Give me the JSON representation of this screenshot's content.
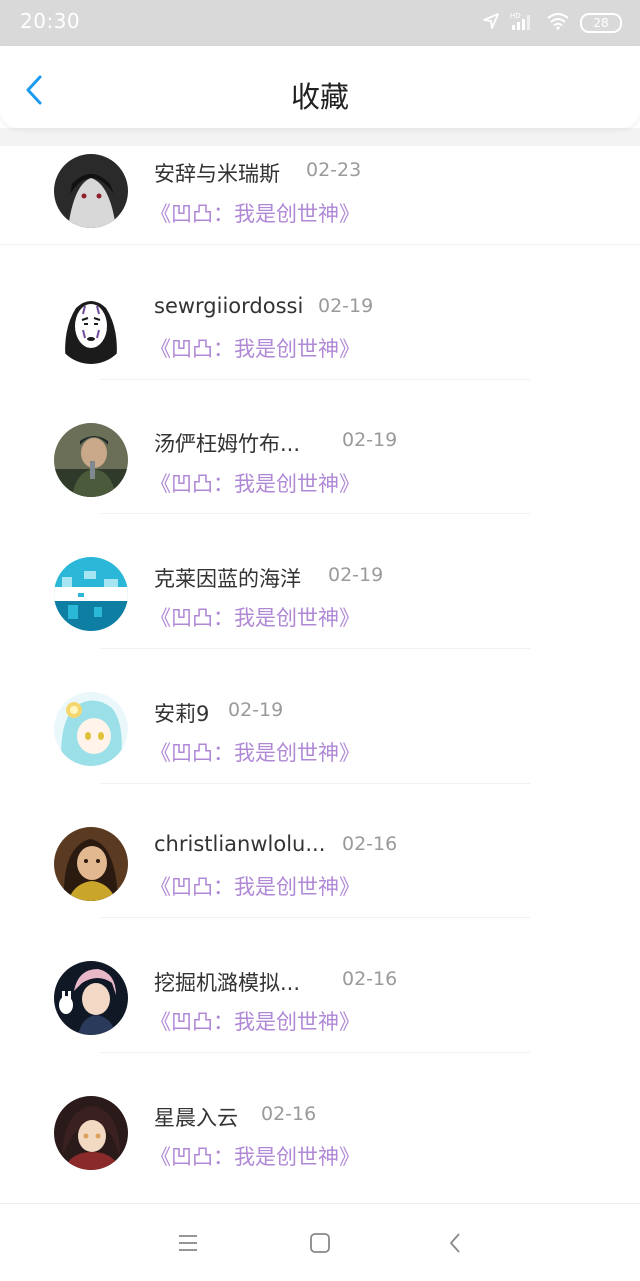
{
  "status_bar": {
    "time": "20:30",
    "battery": "28",
    "icons": [
      "location-icon",
      "hd-signal-icon",
      "wifi-icon",
      "battery-icon"
    ]
  },
  "header": {
    "title": "收藏",
    "back_icon": "chevron-left-icon",
    "accent_color": "#1a9af0"
  },
  "list": {
    "work_color": "#b089d6",
    "items": [
      {
        "name": "安辞与米瑞斯",
        "date": "02-23",
        "work": "《凹凸：我是创世神》",
        "avatar_palette": [
          "#2a2a2a",
          "#d8d8d8",
          "#8c1f2a"
        ]
      },
      {
        "name": "sewrgiiordossi",
        "date": "02-19",
        "work": "《凹凸：我是创世神》",
        "avatar_palette": [
          "#1b1b1b",
          "#ffffff",
          "#6f4c9b"
        ]
      },
      {
        "name": "汤俨枉姆竹布...",
        "date": "02-19",
        "work": "《凹凸：我是创世神》",
        "avatar_palette": [
          "#6c6f57",
          "#c9a98a",
          "#2f3a2a"
        ]
      },
      {
        "name": "克莱因蓝的海洋",
        "date": "02-19",
        "work": "《凹凸：我是创世神》",
        "avatar_palette": [
          "#2bb7d8",
          "#a6e6f2",
          "#0f7ea3"
        ]
      },
      {
        "name": "安莉9",
        "date": "02-19",
        "work": "《凹凸：我是创世神》",
        "avatar_palette": [
          "#eaf8fb",
          "#9be0e8",
          "#f5d76e"
        ]
      },
      {
        "name": "christlianwlolu...",
        "date": "02-16",
        "work": "《凹凸：我是创世神》",
        "avatar_palette": [
          "#5a3b22",
          "#e1b88f",
          "#c9a52a"
        ]
      },
      {
        "name": "挖掘机潞模拟...",
        "date": "02-16",
        "work": "《凹凸：我是创世神》",
        "avatar_palette": [
          "#101825",
          "#e9b8c8",
          "#ffffff"
        ]
      },
      {
        "name": "星晨入云",
        "date": "02-16",
        "work": "《凹凸：我是创世神》",
        "avatar_palette": [
          "#2a1a1a",
          "#e0a060",
          "#8a2a2a"
        ]
      }
    ]
  },
  "nav_bar": {
    "buttons": [
      "menu-icon",
      "home-icon",
      "back-icon"
    ]
  }
}
